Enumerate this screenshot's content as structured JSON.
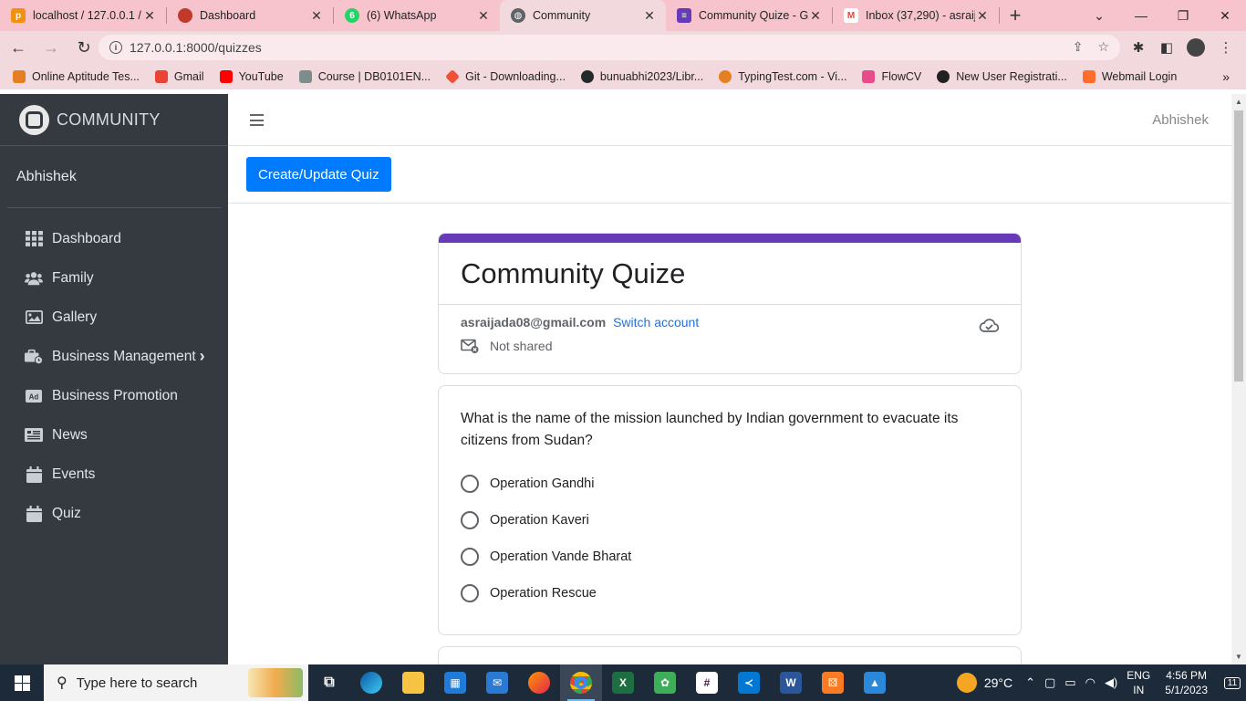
{
  "browser": {
    "tabs": [
      {
        "title": "localhost / 127.0.0.1 /",
        "color": "#f29111",
        "icon": "phpmyadmin-icon"
      },
      {
        "title": "Dashboard",
        "color": "#c0392b",
        "icon": "dashboard-favicon"
      },
      {
        "title": "(6) WhatsApp",
        "color": "#25d366",
        "icon": "whatsapp-icon"
      },
      {
        "title": "Community",
        "color": "#5f6368",
        "icon": "globe-icon"
      },
      {
        "title": "Community Quize - G",
        "color": "#673ab7",
        "icon": "google-forms-icon"
      },
      {
        "title": "Inbox (37,290) - asraij",
        "color": "#ea4335",
        "icon": "gmail-icon"
      }
    ],
    "active_tab": 3,
    "url": "127.0.0.1:8000/quizzes",
    "bookmarks": [
      {
        "label": "Online Aptitude Tes...",
        "color": "#e67e22"
      },
      {
        "label": "Gmail",
        "color": "#ea4335"
      },
      {
        "label": "YouTube",
        "color": "#ff0000"
      },
      {
        "label": "Course | DB0101EN...",
        "color": "#7f8c8d"
      },
      {
        "label": "Git - Downloading...",
        "color": "#f05033"
      },
      {
        "label": "bunuabhi2023/Libr...",
        "color": "#24292e"
      },
      {
        "label": "TypingTest.com - Vi...",
        "color": "#e67e22"
      },
      {
        "label": "FlowCV",
        "color": "#e84a8a"
      },
      {
        "label": "New User Registrati...",
        "color": "#222222"
      },
      {
        "label": "Webmail Login",
        "color": "#ff6c2c"
      }
    ]
  },
  "app": {
    "brand": "COMMUNITY",
    "user": "Abhishek",
    "nav_user": "Abhishek",
    "menu": [
      {
        "label": "Dashboard",
        "icon": "grid-icon"
      },
      {
        "label": "Family",
        "icon": "users-icon"
      },
      {
        "label": "Gallery",
        "icon": "image-icon"
      },
      {
        "label": "Business Management",
        "icon": "briefcase-icon",
        "chevron": "›"
      },
      {
        "label": "Business Promotion",
        "icon": "ad-icon"
      },
      {
        "label": "News",
        "icon": "newspaper-icon"
      },
      {
        "label": "Events",
        "icon": "calendar-icon"
      },
      {
        "label": "Quiz",
        "icon": "calendar-icon"
      }
    ],
    "create_button": "Create/Update Quiz"
  },
  "form": {
    "title": "Community Quize",
    "email": "asraijada08@gmail.com",
    "switch_account": "Switch account",
    "shared_status": "Not shared",
    "accent": "#673ab7",
    "question": "What is the name of the mission launched by Indian government to evacuate its citizens from Sudan?",
    "options": [
      "Operation Gandhi",
      "Operation Kaveri",
      "Operation Vande Bharat",
      "Operation Rescue"
    ]
  },
  "taskbar": {
    "search_placeholder": "Type here to search",
    "weather": "29°C",
    "lang_top": "ENG",
    "lang_bottom": "IN",
    "time": "4:56 PM",
    "date": "5/1/2023",
    "notifications": "11"
  }
}
